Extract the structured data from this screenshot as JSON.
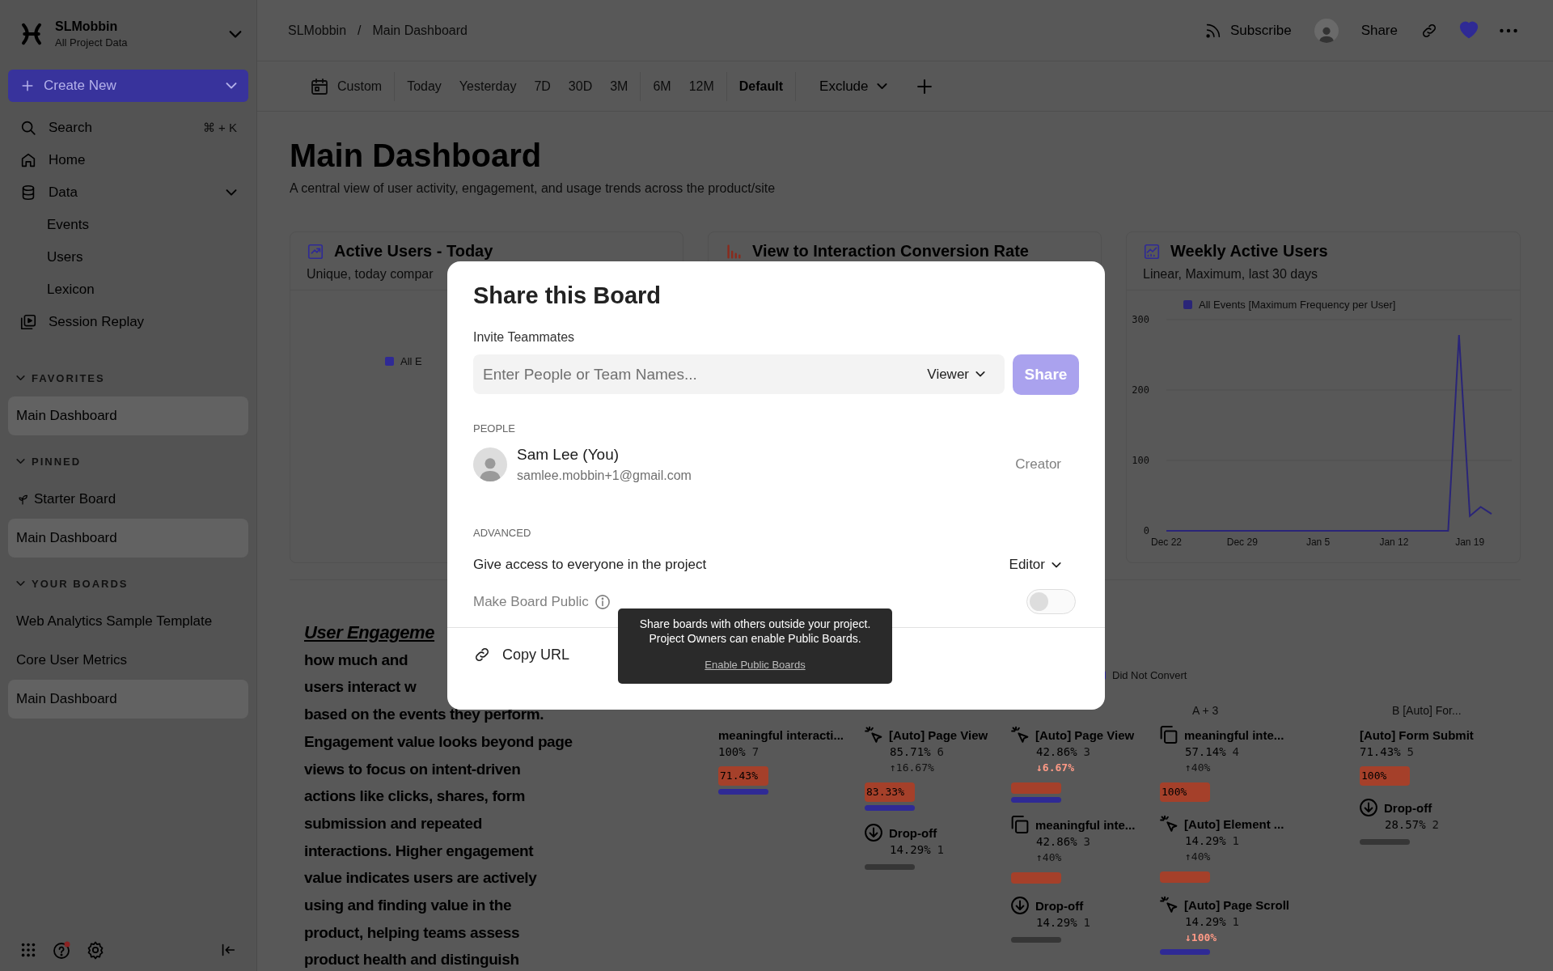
{
  "sidebar": {
    "workspace": {
      "name": "SLMobbin",
      "subtitle": "All Project Data"
    },
    "create_button": "Create New",
    "nav": [
      {
        "label": "Search",
        "shortcut": "⌘ + K"
      },
      {
        "label": "Home"
      },
      {
        "label": "Data",
        "expanded": true,
        "children": [
          {
            "label": "Events"
          },
          {
            "label": "Users"
          },
          {
            "label": "Lexicon"
          }
        ]
      },
      {
        "label": "Session Replay"
      }
    ],
    "sections": [
      {
        "title": "FAVORITES",
        "expanded": true,
        "items": [
          {
            "label": "Main Dashboard",
            "kind": "board",
            "selected": true
          }
        ]
      },
      {
        "title": "PINNED",
        "expanded": true,
        "items": [
          {
            "label": "Starter Board",
            "kind": "starter",
            "selected": false
          },
          {
            "label": "Main Dashboard",
            "kind": "board",
            "selected": true
          }
        ]
      },
      {
        "title": "YOUR BOARDS",
        "expanded": true,
        "items": [
          {
            "label": "Web Analytics Sample Template",
            "kind": "board",
            "selected": false
          },
          {
            "label": "Core User Metrics",
            "kind": "board",
            "selected": false
          },
          {
            "label": "Main Dashboard",
            "kind": "board",
            "selected": true
          }
        ]
      }
    ]
  },
  "topbar": {
    "breadcrumb": [
      "SLMobbin",
      "Main Dashboard"
    ],
    "separator": "/",
    "subscribe": "Subscribe",
    "share": "Share",
    "favorited": true
  },
  "filter_groups": [
    [
      {
        "label": "Custom",
        "selected": false
      }
    ],
    [
      {
        "label": "Today",
        "selected": false
      },
      {
        "label": "Yesterday",
        "selected": false
      },
      {
        "label": "7D",
        "selected": false
      },
      {
        "label": "30D",
        "selected": false
      },
      {
        "label": "3M",
        "selected": false
      }
    ],
    [
      {
        "label": "6M",
        "selected": false
      },
      {
        "label": "12M",
        "selected": false
      }
    ],
    [
      {
        "label": "Default",
        "selected": true
      }
    ]
  ],
  "exclude": "Exclude",
  "page": {
    "title": "Main Dashboard",
    "description": "A central view of user activity, engagement, and usage trends across the product/site"
  },
  "cards": [
    {
      "kind": "insights",
      "title": "Active Users - Today",
      "subtitle": "Unique, today compar",
      "legend": "All E"
    },
    {
      "kind": "funnel",
      "title": "View to Interaction Conversion Rate"
    },
    {
      "kind": "line",
      "title": "Weekly Active Users",
      "subtitle": "Linear, Maximum, last 30 days",
      "chart_data": {
        "type": "line",
        "categories": [
          "Dec 22",
          null,
          null,
          null,
          null,
          null,
          null,
          "Dec 29",
          null,
          null,
          null,
          null,
          null,
          null,
          "Jan 5",
          null,
          null,
          null,
          null,
          null,
          null,
          "Jan 12",
          null,
          null,
          null,
          null,
          null,
          null,
          "Jan 19",
          null,
          null
        ],
        "series": [
          {
            "name": "All Events [Maximum Frequency per User]",
            "color": "#2a2578",
            "values": [
              0,
              0,
              0,
              0,
              0,
              0,
              0,
              0,
              0,
              0,
              0,
              0,
              0,
              0,
              0,
              0,
              0,
              0,
              0,
              0,
              0,
              0,
              0,
              0,
              0,
              0,
              0,
              278,
              21,
              34,
              24
            ]
          }
        ],
        "ylim": [
          0,
          300
        ],
        "yticks": [
          0,
          100,
          200,
          300
        ]
      }
    }
  ],
  "notes": {
    "heading": "User Engageme",
    "fragments": [
      "how much and",
      "users interact w"
    ],
    "paragraph": "based on the events they perform.\nEngagement value looks beyond page\nviews to focus on intent-driven\nactions like clicks, shares, form\nsubmission and repeated\ninteractions. Higher engagement\nvalue indicates users are actively\nusing and finding value in the\nproduct, helping teams assess\nproduct health and distinguish"
  },
  "funnel": {
    "legend": [
      {
        "label": "Did Not Convert",
        "color": "#2f2a95"
      }
    ],
    "columns": [
      {
        "steps": [
          {
            "kind": "event",
            "name": "meaningful interacti...",
            "percent": "100%",
            "count": "7",
            "bars": [
              {
                "kind": "converted",
                "label": "71.43%"
              },
              {
                "kind": "not-converted"
              }
            ]
          }
        ]
      },
      {
        "steps": [
          {
            "kind": "click",
            "name": "[Auto] Page View",
            "percent": "85.71%",
            "count": "6",
            "change": "↑16.67%",
            "decrease": false,
            "bars": [
              {
                "kind": "converted",
                "label": "83.33%"
              },
              {
                "kind": "not-converted"
              }
            ]
          },
          {
            "kind": "dropoff",
            "name": "Drop-off",
            "percent": "14.29%",
            "count": "1",
            "bars": [
              {
                "kind": "dropped"
              }
            ]
          }
        ]
      },
      {
        "steps": [
          {
            "kind": "click",
            "name": "[Auto] Page View",
            "percent": "42.86%",
            "count": "3",
            "change": "↓6.67%",
            "decrease": true,
            "bars": [
              {
                "kind": "converted"
              },
              {
                "kind": "not-converted"
              }
            ]
          },
          {
            "kind": "custom",
            "name": "meaningful inte...",
            "percent": "42.86%",
            "count": "3",
            "change": "↑40%",
            "decrease": false,
            "bars": [
              {
                "kind": "converted"
              }
            ]
          },
          {
            "kind": "dropoff",
            "name": "Drop-off",
            "percent": "14.29%",
            "count": "1",
            "bars": [
              {
                "kind": "dropped"
              }
            ]
          }
        ]
      },
      {
        "header": "A + 3",
        "steps": [
          {
            "kind": "custom",
            "name": "meaningful inte...",
            "percent": "57.14%",
            "count": "4",
            "change": "↑40%",
            "decrease": false,
            "bars": [
              {
                "kind": "converted",
                "label": "100%"
              }
            ]
          },
          {
            "kind": "click",
            "name": "[Auto] Element ...",
            "percent": "14.29%",
            "count": "1",
            "change": "↑40%",
            "decrease": false,
            "bars": [
              {
                "kind": "converted"
              }
            ]
          },
          {
            "kind": "click",
            "name": "[Auto] Page Scroll",
            "percent": "14.29%",
            "count": "1",
            "change": "↓100%",
            "decrease": true,
            "bars": [
              {
                "kind": "not-converted"
              }
            ]
          }
        ]
      },
      {
        "header": "B [Auto] For...",
        "steps": [
          {
            "kind": "event",
            "name": "[Auto] Form Submit",
            "percent": "71.43%",
            "count": "5",
            "bars": [
              {
                "kind": "converted",
                "label": "100%"
              }
            ]
          },
          {
            "kind": "dropoff",
            "name": "Drop-off",
            "percent": "28.57%",
            "count": "2",
            "bars": [
              {
                "kind": "dropped"
              }
            ]
          }
        ]
      }
    ]
  },
  "share_modal": {
    "title": "Share this Board",
    "invite_label": "Invite Teammates",
    "invite_field": {
      "placeholder": "Enter People or Team Names..."
    },
    "role": "Viewer",
    "share_button": {
      "label": "Share",
      "disabled": true
    },
    "people_heading": "PEOPLE",
    "people": [
      {
        "name": "Sam Lee (You)",
        "email": "samlee.mobbin+1@gmail.com",
        "role": "Creator"
      }
    ],
    "advanced_heading": "ADVANCED",
    "project_access": {
      "label": "Give access to everyone in the project",
      "role": "Editor"
    },
    "public": {
      "label": "Make Board Public",
      "on": false,
      "disabled": true
    },
    "copy_url": "Copy URL",
    "tooltip": {
      "text": "Share boards with others outside your project.\nProject Owners can enable Public Boards.",
      "link": "Enable Public Boards"
    }
  }
}
